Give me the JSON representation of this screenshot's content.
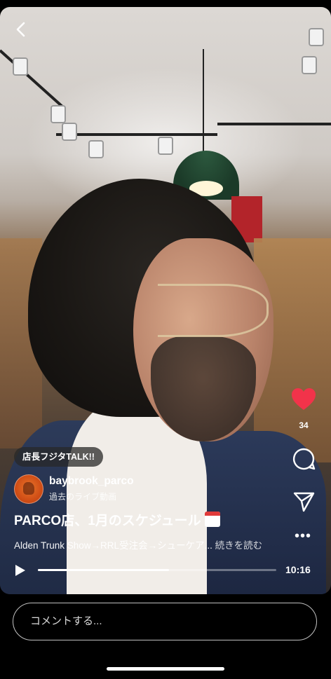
{
  "video": {
    "tag_label": "店長フジタTALK!!",
    "username": "baybrook_parco",
    "subtitle": "過去のライブ動画",
    "title": "PARCO店、1月のスケジュール",
    "description": "Alden Trunk Show→RRL受注会→シューケア...",
    "more_label": "続きを読む",
    "time": "10:16",
    "progress_fraction": 0.55
  },
  "actions": {
    "like_count": "34",
    "like_color": "#f2334a"
  },
  "comment": {
    "placeholder": "コメントする..."
  },
  "icons": [
    "back-icon",
    "heart-icon",
    "comment-icon",
    "share-icon",
    "more-icon",
    "play-icon",
    "calendar-icon"
  ]
}
